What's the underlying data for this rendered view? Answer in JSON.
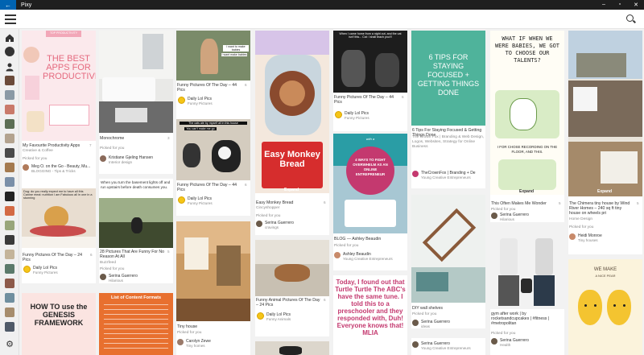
{
  "titlebar": {
    "app_name": "Pixy",
    "back_glyph": "←",
    "min_glyph": "–",
    "max_glyph": "▫",
    "close_glyph": "✕"
  },
  "rail": {
    "icons": [
      "home-icon",
      "search-category-icon",
      "user-profile-icon",
      "board-icon",
      "board-icon",
      "board-icon",
      "board-icon",
      "board-icon",
      "board-icon",
      "board-icon",
      "board-icon",
      "board-icon",
      "board-icon",
      "board-icon",
      "board-icon",
      "board-icon",
      "board-icon",
      "settings-gear-icon"
    ]
  },
  "pins": {
    "c1a": {
      "overlay_small": "TOP PRODUCTIVITY",
      "overlay_big": "THE BEST APPS FOR PRODUCTIVITY",
      "caption": "My Favourite Productivity Apps",
      "sub": "Creative & Coffee",
      "stat": "7",
      "picked": "Picked for you",
      "user": "Meg O. on the Go - Beauty, Mu...",
      "user_cat": "BLOGGING - Tips & Tricks"
    },
    "c1b": {
      "overlay": "Dog: do you really expect me to have all this\nCanine meal: nutrition I am Fabulous all in one in a stunning",
      "caption": "Funny Pictures Of The Day – 24 Pics",
      "stat": "6",
      "user": "Daily Lol Pics",
      "user_cat": "Funny Pictures"
    },
    "c1c": {
      "overlay": "HOW TO use the GENESIS FRAMEWORK"
    },
    "c2a": {
      "caption": "Monochrome",
      "stat": "3",
      "picked": "Picked for you",
      "user": "Kristiane Gjeling Hansen",
      "user_cat": "Interior design"
    },
    "c2b": {
      "overlay": "When you turn the basement lights off and run upstairs before death consumes you.",
      "caption": "28 Pictures That Are Funny For No Reason At All",
      "sub": "Buzzfeed",
      "stat": "5",
      "picked": "Picked for you",
      "user": "Serina Guerrero",
      "user_cat": "Hilarious"
    },
    "c2c": {
      "overlay": "List of Content Formats"
    },
    "c3a": {
      "bubble1": "I want to make babies",
      "bubble2": "I want make babies",
      "caption": "Funny Pictures Of The Day – 44 Pics",
      "stat": "6",
      "user": "Daily Lol Pics",
      "user_cat": "Funny Pictures"
    },
    "c3b": {
      "bubble1": "The cats ate by myself all in this house",
      "bubble2": "You can't make me go",
      "caption": "Funny Pictures Of The Day – 44 Pics",
      "stat": "6",
      "user": "Daily Lol Pics",
      "user_cat": "Funny Pictures"
    },
    "c3c": {
      "caption": "Tiny house",
      "stat": "",
      "picked": "Picked for you",
      "user": "Carolyn Zewe",
      "user_cat": "Tiny homes"
    },
    "c4a": {
      "overlay": "Easy Monkey Bread",
      "expand": "Expand",
      "caption": "Easy Monkey Bread",
      "sub": "Cincyshopper",
      "stat": "6",
      "picked": "Picked for you",
      "user": "Serina Guerrero",
      "user_cat": "cravings"
    },
    "c4b": {
      "caption": "Funny Animal Pictures Of The Day – 24 Pics",
      "stat": "6",
      "user": "Daily Lol Pics",
      "user_cat": "Funny Animals"
    },
    "c5a": {
      "overlay": "When I came home from a night out, and the cat isn't this... Cat: I shall teach you!!!",
      "caption": "Funny Pictures Of The Day – 44 Pics",
      "stat": "6",
      "user": "Daily Lol Pics",
      "user_cat": "Funny Pictures"
    },
    "c5b": {
      "overlay_top": "with a",
      "overlay_big": "4 WAYS TO FIGHT OVERWHELM AS AN ONLINE ENTREPRENEUR",
      "caption": "BLOG — Ashley Beaudin",
      "stat": "",
      "picked": "Picked for you",
      "user": "Ashley Beaudin",
      "user_cat": "Young Creative Entrepreneurs"
    },
    "c5c": {
      "overlay": "Today, I found out that Turtle Turtle The ABC's have the same tune. I told this to a preschooler and they responded with, Duh! Everyone knows that! MLIA"
    },
    "c6a": {
      "overlay": "6 TIPS FOR STAYING FOCUSED + GETTING THINGS DONE",
      "caption": "6 Tips For Staying Focused & Getting Things Done",
      "sub": "The Crown Fox | Branding & Web Design, Logos, Websites, Strategy for Online Business",
      "user": "TheCrownFox | Branding + De",
      "user_cat": "Young Creative Entrepreneurs"
    },
    "c6b": {
      "caption": "DIY wall shelves",
      "stat": "",
      "picked": "Picked for you",
      "user": "Serina Guerrero",
      "user_cat": "ideas"
    },
    "c6c": {
      "user": "Serina Guerrero",
      "user_cat": "Young Creative Entrepreneurs"
    },
    "c7a": {
      "overlay": "WHAT IF WHEN WE WERE BABIES, WE GOT TO CHOOSE OUR TALENTS?",
      "overlay2": "I FOR CHOSE RECORDING ON THE FLOOR, AND THIS.",
      "expand": "Expand",
      "caption": "This Often Makes Me Wonder",
      "stat": "5",
      "picked": "Picked for you",
      "user": "Serina Guerrero",
      "user_cat": "Hilarious"
    },
    "c7b": {
      "caption": "gym after work | by rocketsandcupcakes | #fitness | #metropolitan",
      "stat": "",
      "picked": "Picked for you",
      "user": "Serina Guerrero",
      "user_cat": "Health"
    },
    "c8a": {
      "expand": "Expand",
      "caption": "The Chimera tiny house by Wind River Homes – 240 sq ft tiny house on wheels pri",
      "sub": "Home Design",
      "stat": "5",
      "picked": "Picked for you",
      "user": "Heidi Monroe",
      "user_cat": "Tiny houses"
    },
    "c8b": {
      "overlay_top": "WE MAKE",
      "overlay_mid": "A NICE PEAR"
    }
  }
}
